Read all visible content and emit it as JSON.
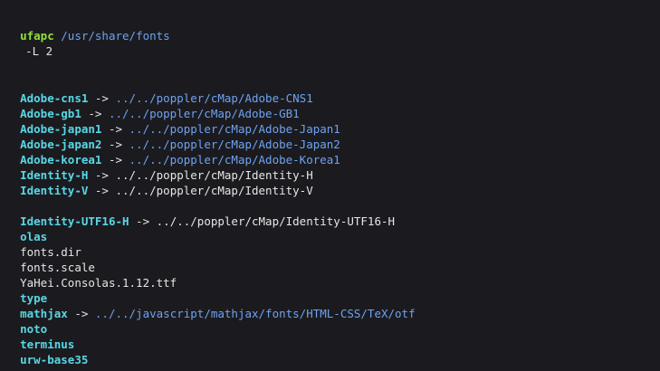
{
  "terminal": {
    "prompt": {
      "host": "ufapc",
      "cwd": "/usr/share/fonts"
    },
    "command_tail": "-L 2",
    "entries": [
      {
        "name": "Adobe-cns1",
        "arrow": " -> ",
        "target": "../../poppler/cMap/Adobe-CNS1"
      },
      {
        "name": "Adobe-gb1",
        "arrow": " -> ",
        "target": "../../poppler/cMap/Adobe-GB1"
      },
      {
        "name": "Adobe-japan1",
        "arrow": " -> ",
        "target": "../../poppler/cMap/Adobe-Japan1"
      },
      {
        "name": "Adobe-japan2",
        "arrow": " -> ",
        "target": "../../poppler/cMap/Adobe-Japan2"
      },
      {
        "name": "Adobe-korea1",
        "arrow": " -> ",
        "target": "../../poppler/cMap/Adobe-Korea1"
      },
      {
        "name": "Identity-H",
        "arrow": " -> ",
        "target": "../../poppler/cMap/Identity-H"
      },
      {
        "name": "Identity-V",
        "arrow": " -> ",
        "target": "../../poppler/cMap/Identity-V"
      },
      {
        "name": "Identity-UTF16-H",
        "arrow": " -> ",
        "target": "../../poppler/cMap/Identity-UTF16-H"
      },
      {
        "name": "olas"
      },
      {
        "name": "fonts.dir"
      },
      {
        "name": "fonts.scale"
      },
      {
        "name": "YaHei.Consolas.1.12.ttf"
      },
      {
        "name": "type"
      },
      {
        "name": "mathjax",
        "arrow": " -> ",
        "target": "../../javascript/mathjax/fonts/HTML-CSS/TeX/otf"
      },
      {
        "name": "noto"
      },
      {
        "name": "terminus"
      },
      {
        "name": "urw-base35"
      }
    ],
    "colors": {
      "background": "#1b1b1f",
      "prompt": "#8fe23a",
      "path": "#6fa2f0",
      "symlink_name": "#58d7e6",
      "text": "#e6e6e6"
    }
  }
}
